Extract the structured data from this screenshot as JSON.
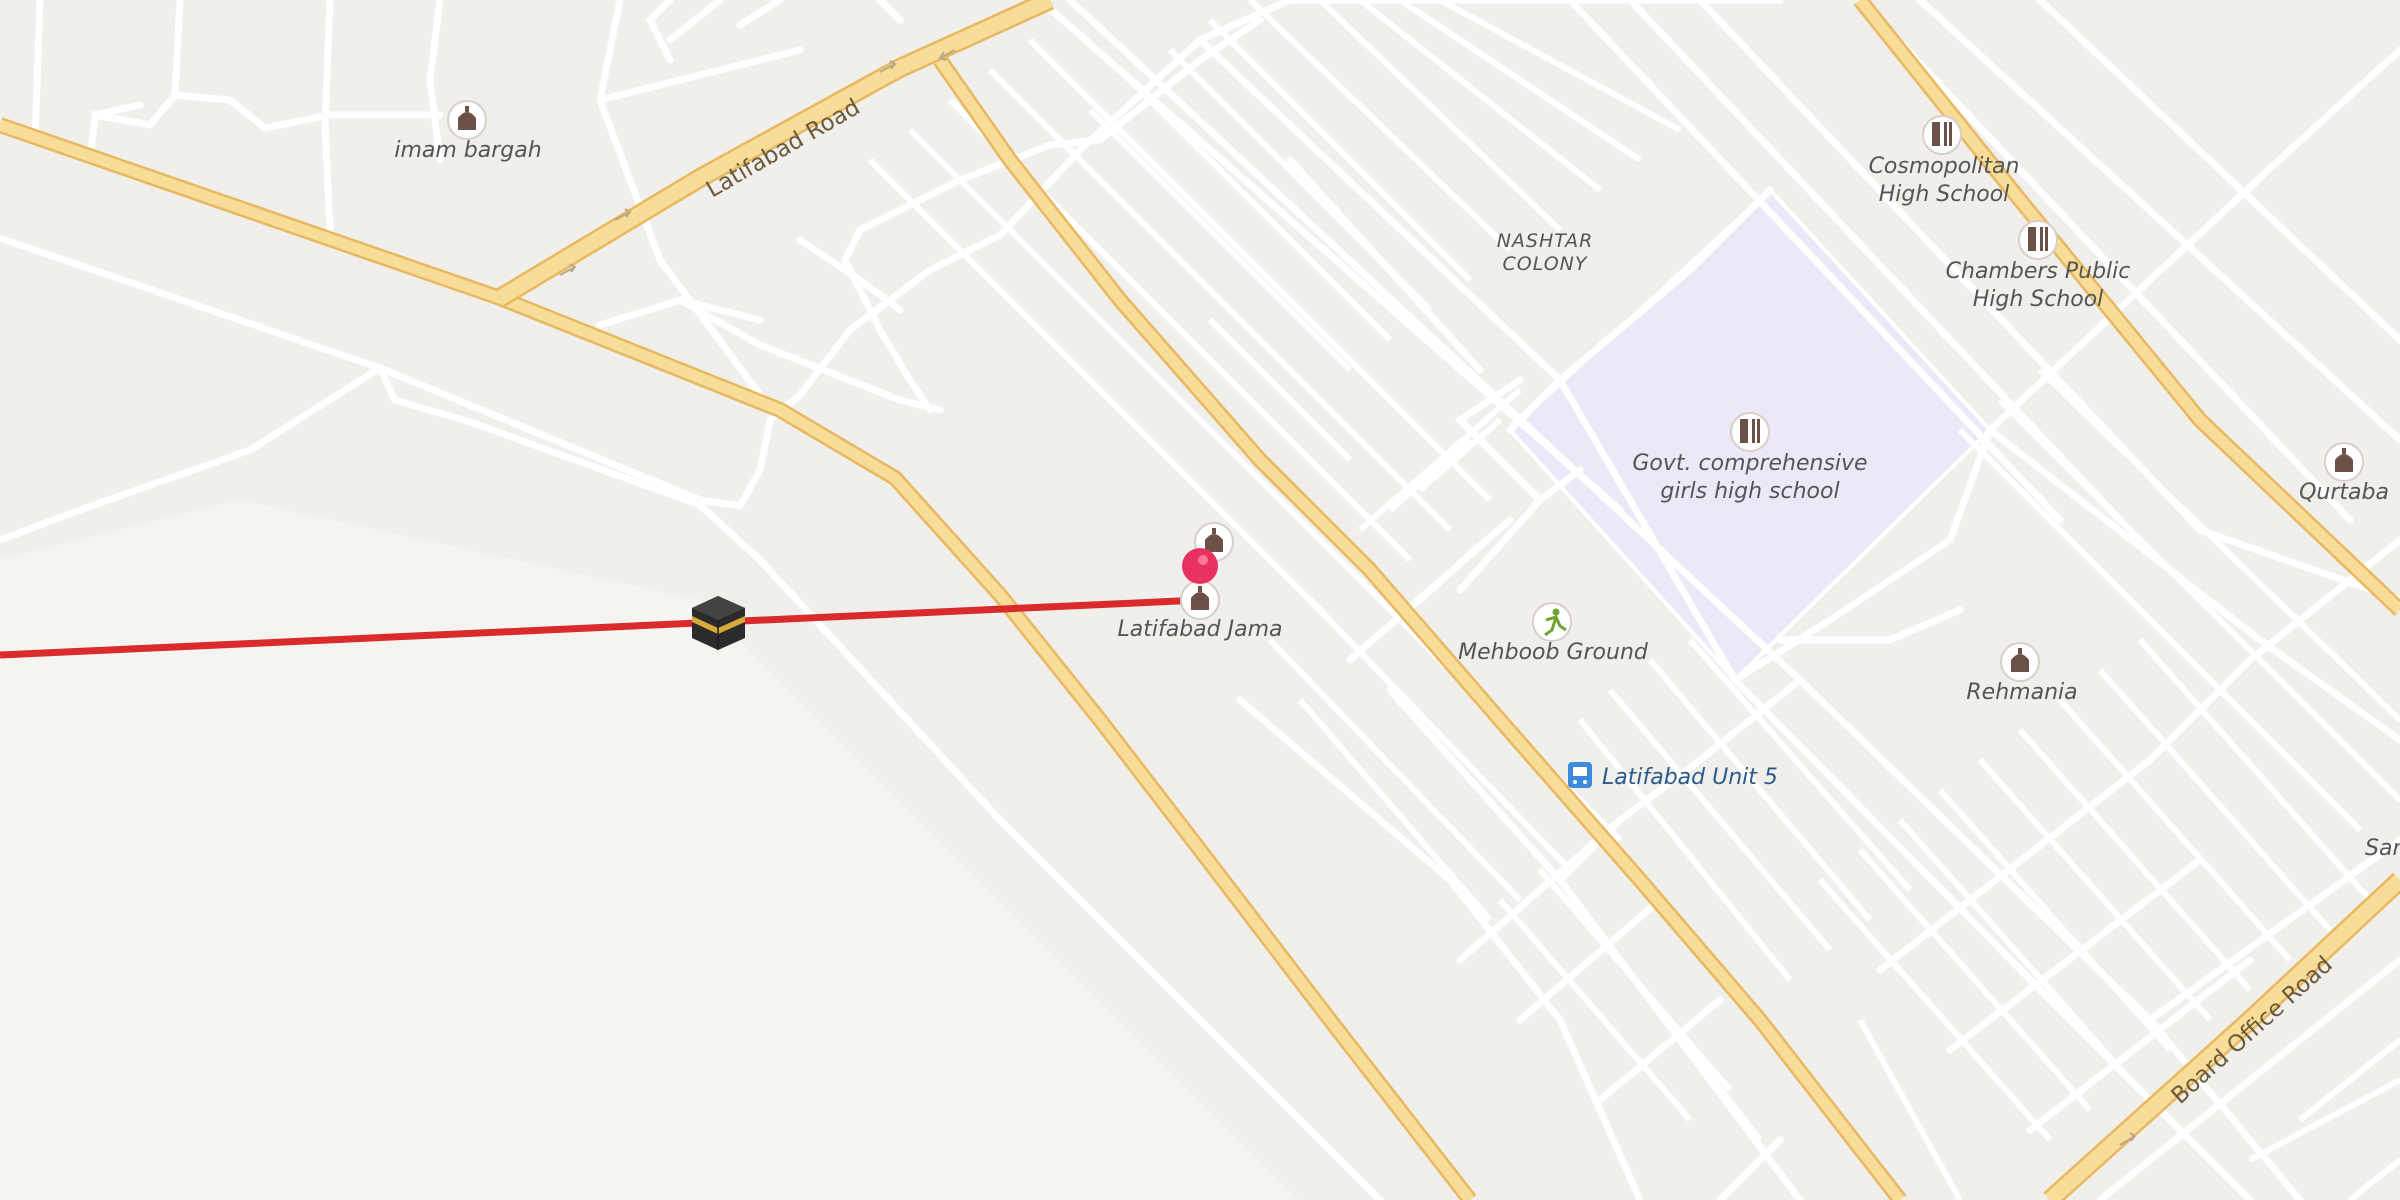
{
  "map": {
    "roads": {
      "latifabad_road": "Latifabad Road",
      "board_office_road": "Board Office Road"
    },
    "areas": {
      "nashtar_colony": [
        "NASHTAR",
        "COLONY"
      ]
    },
    "pois": {
      "imam_bargah": "imam bargah",
      "cosmopolitan": [
        "Cosmopolitan",
        "High School"
      ],
      "chambers": [
        "Chambers Public",
        "High School"
      ],
      "govt_school": [
        "Govt. comprehensive",
        "girls high school"
      ],
      "qurtaba": "Qurtaba",
      "latifabad_jama": "Latifabad Jama",
      "mehboob_ground": "Mehboob Ground",
      "rehmania": "Rehmania",
      "san": "San"
    },
    "transit": {
      "bus_stop": "Latifabad Unit 5"
    },
    "icons": [
      "mosque-icon",
      "school-icon",
      "sports-icon",
      "bus-stop-icon",
      "location-pin-icon",
      "kaaba-icon"
    ],
    "colors": {
      "background": "#f1efec",
      "major_road": "#f7d98f",
      "major_road_casing": "#e8b860",
      "minor_road": "#ffffff",
      "school_area": "#ece8f7",
      "qibla_line": "#d92b2b",
      "pin": "#e8315f"
    }
  }
}
